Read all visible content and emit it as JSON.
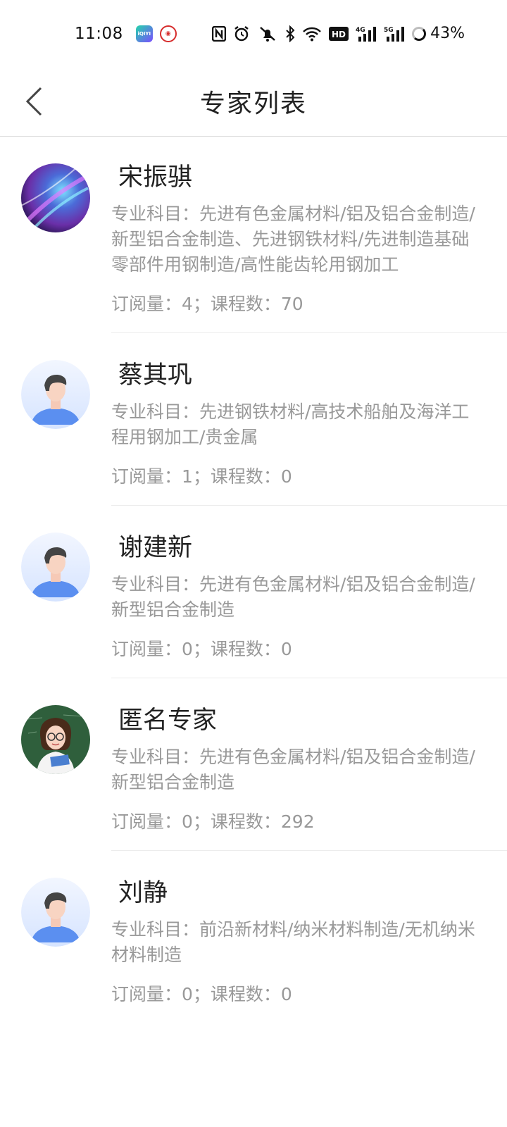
{
  "status_bar": {
    "time": "11:08",
    "battery": "43%",
    "icons": [
      "iqiyi-app-icon",
      "app-notification-icon",
      "nfc-icon",
      "alarm-icon",
      "mute-icon",
      "bluetooth-icon",
      "wifi-icon",
      "hd-icon",
      "4g-signal-icon",
      "5g-signal-icon",
      "battery-icon"
    ],
    "hd_label": "HD",
    "net_4g": "4G",
    "net_5g": "5G"
  },
  "header": {
    "title": "专家列表",
    "back_icon": "chevron-left-icon"
  },
  "experts": [
    {
      "name": "宋振骐",
      "subjects": "专业科目：先进有色金属材料/铝及铝合金制造/新型铝合金制造、先进钢铁材料/先进制造基础零部件用钢制造/高性能齿轮用钢加工",
      "stats": "订阅量：4；课程数：70",
      "avatar": "galaxy-avatar"
    },
    {
      "name": "蔡其巩",
      "subjects": "专业科目：先进钢铁材料/高技术船舶及海洋工程用钢加工/贵金属",
      "stats": "订阅量：1；课程数：0",
      "avatar": "default-person-avatar"
    },
    {
      "name": "谢建新",
      "subjects": "专业科目：先进有色金属材料/铝及铝合金制造/新型铝合金制造",
      "stats": "订阅量：0；课程数：0",
      "avatar": "default-person-avatar"
    },
    {
      "name": "匿名专家",
      "subjects": "专业科目：先进有色金属材料/铝及铝合金制造/新型铝合金制造",
      "stats": "订阅量：0；课程数：292",
      "avatar": "teacher-avatar"
    },
    {
      "name": "刘静",
      "subjects": "专业科目：前沿新材料/纳米材料制造/无机纳米材料制造",
      "stats": "订阅量：0；课程数：0",
      "avatar": "default-person-avatar"
    }
  ],
  "colors": {
    "title": "#222222",
    "secondary_text": "#999999",
    "divider": "#ececec",
    "avatar_blue": "#5b8ff0"
  }
}
